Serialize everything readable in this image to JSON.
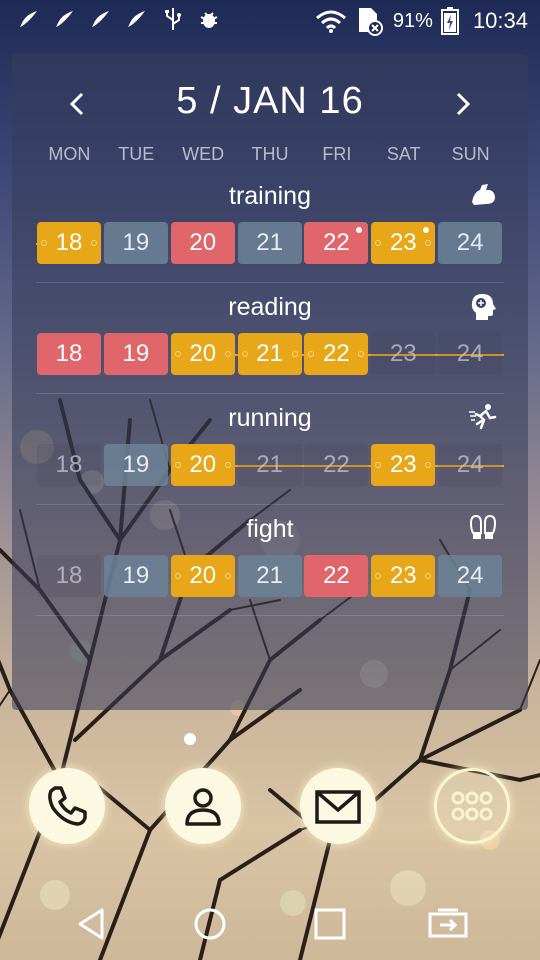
{
  "status_bar": {
    "battery": "91%",
    "time": "10:34",
    "notification_icons": [
      "leaf-icon",
      "leaf-icon",
      "leaf-icon",
      "leaf-icon",
      "usb-icon",
      "bug-icon"
    ]
  },
  "widget": {
    "week_title": "5 / JAN 16",
    "prev_label": "‹",
    "next_label": "›",
    "days": [
      "MON",
      "TUE",
      "WED",
      "THU",
      "FRI",
      "SAT",
      "SUN"
    ],
    "habits": [
      {
        "name": "training",
        "icon": "muscle-arm-icon",
        "cells": [
          {
            "day": "18",
            "state": "done"
          },
          {
            "day": "19",
            "state": "skip"
          },
          {
            "day": "20",
            "state": "missed"
          },
          {
            "day": "21",
            "state": "skip"
          },
          {
            "day": "22",
            "state": "missed"
          },
          {
            "day": "23",
            "state": "done"
          },
          {
            "day": "24",
            "state": "skip"
          }
        ]
      },
      {
        "name": "reading",
        "icon": "head-brain-icon",
        "cells": [
          {
            "day": "18",
            "state": "missed"
          },
          {
            "day": "19",
            "state": "missed"
          },
          {
            "day": "20",
            "state": "done"
          },
          {
            "day": "21",
            "state": "done"
          },
          {
            "day": "22",
            "state": "done"
          },
          {
            "day": "23",
            "state": "none"
          },
          {
            "day": "24",
            "state": "none"
          }
        ]
      },
      {
        "name": "running",
        "icon": "runner-icon",
        "cells": [
          {
            "day": "18",
            "state": "none"
          },
          {
            "day": "19",
            "state": "skip"
          },
          {
            "day": "20",
            "state": "done"
          },
          {
            "day": "21",
            "state": "none"
          },
          {
            "day": "22",
            "state": "none"
          },
          {
            "day": "23",
            "state": "done"
          },
          {
            "day": "24",
            "state": "none"
          }
        ]
      },
      {
        "name": "fight",
        "icon": "boxing-gloves-icon",
        "cells": [
          {
            "day": "18",
            "state": "none"
          },
          {
            "day": "19",
            "state": "skip"
          },
          {
            "day": "20",
            "state": "done"
          },
          {
            "day": "21",
            "state": "skip"
          },
          {
            "day": "22",
            "state": "missed"
          },
          {
            "day": "23",
            "state": "done"
          },
          {
            "day": "24",
            "state": "skip"
          }
        ]
      }
    ]
  },
  "colors": {
    "done": "#e8a619",
    "missed": "#e0666c",
    "skip": "#6c8296",
    "streak": "#e7a320"
  },
  "dock": [
    "phone-icon",
    "contacts-icon",
    "mail-icon",
    "app-drawer-icon"
  ],
  "nav_bar": [
    "back-icon",
    "home-icon",
    "recents-icon",
    "screen-mirror-icon"
  ]
}
